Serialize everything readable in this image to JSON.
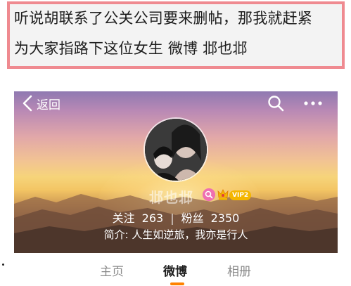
{
  "quote": {
    "line1": "听说胡联系了公关公司要来删帖，那我就赶紧",
    "line2": "为大家指路下这位女生 微博 邶也邶"
  },
  "profile": {
    "back_label": "返回",
    "search_icon": "search-icon",
    "more_icon": "more-dots-icon",
    "user_name": "邶也邶",
    "vip_label": "VIP2",
    "following_label": "关注",
    "following_count": "263",
    "stats_separator": "|",
    "followers_label": "粉丝",
    "followers_count": "2350",
    "bio": "简介: 人生如逆旅，我亦是行人"
  },
  "tabs": [
    {
      "label": "主页",
      "active": false
    },
    {
      "label": "微博",
      "active": true
    },
    {
      "label": "相册",
      "active": false
    }
  ],
  "colors": {
    "quote_border": "#ef8a90",
    "tab_accent": "#ff8200",
    "vip_badge": "#f4b600"
  }
}
